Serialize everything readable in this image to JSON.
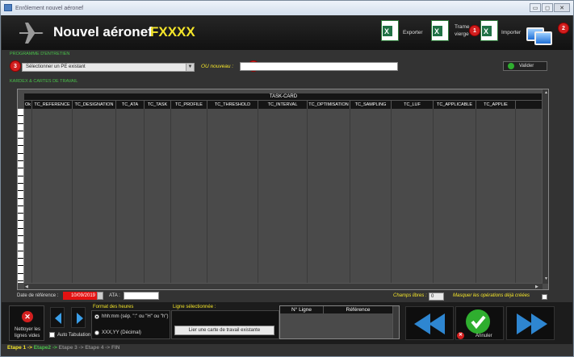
{
  "window": {
    "title": "Enrôlement nouvel aéronef"
  },
  "header": {
    "title": "Nouvel aéronef",
    "registration": "FXXXX",
    "export_label": "Exporter",
    "trame_label_line1": "Trame",
    "trame_label_line2": "vierge",
    "import_label": "Importer"
  },
  "badges": {
    "b1": "1",
    "b2": "2",
    "b3": "3",
    "b4": "4"
  },
  "programme": {
    "section_title": "PROGRAMME D'ENTRETIEN",
    "select_value": "Sélectionner un PE existant",
    "or_new_label": "OU nouveau :",
    "new_value": "",
    "validate_label": "Valider"
  },
  "kardex": {
    "section_title": "KARDEX & CARTES DE TRAVAIL",
    "group_header": "TASK-CARD",
    "columns": [
      "Ok",
      "TC_REFERENCE",
      "TC_DESIGNATION",
      "TC_ATA",
      "TC_TASK",
      "TC_PROFILE",
      "TC_THRESHOLD",
      "TC_INTERVAL",
      "TC_OPTIMISATION",
      "TC_SAMPLING",
      "TC_LUF",
      "TC_APPLICABLE",
      "TC_APPLIE"
    ]
  },
  "footer": {
    "ref_date_label": "Date de référence :",
    "ref_date_value": "10/09/2019",
    "ata_label": "ATA :",
    "ata_value": "",
    "free_fields_label": "Champs libres :",
    "free_fields_value": "0",
    "hide_ops_label": "Masquer les opérations déjà créées"
  },
  "bottom": {
    "clean_label_line1": "Nettoyer les",
    "clean_label_line2": "lignes vides",
    "auto_tab_label": "Auto Tabulation",
    "hours_format_title": "Format des heures",
    "format1_label": "hhh:mm (sép. \":\" ou \"H\" ou \"h\")",
    "format2_label": "XXX,YY (Décimal)",
    "selected_line_title": "Ligne sélectionnée :",
    "link_button_label": "Lier une carte de travail existante",
    "line_table_col1": "N° Ligne",
    "line_table_col2": "Référence",
    "cancel_label": "Annuler"
  },
  "steps": {
    "step1": "Etape 1 ->",
    "step2": "Etape2 ->",
    "step3": "Etape 3 ->",
    "step4": "Etape 4 -> FIN"
  },
  "colors": {
    "accent_green": "#49c04a",
    "registration_yellow": "#f5e62a",
    "date_red": "#e41212",
    "badge_red": "#d21f1f",
    "nav_blue": "#3a9ee8"
  }
}
